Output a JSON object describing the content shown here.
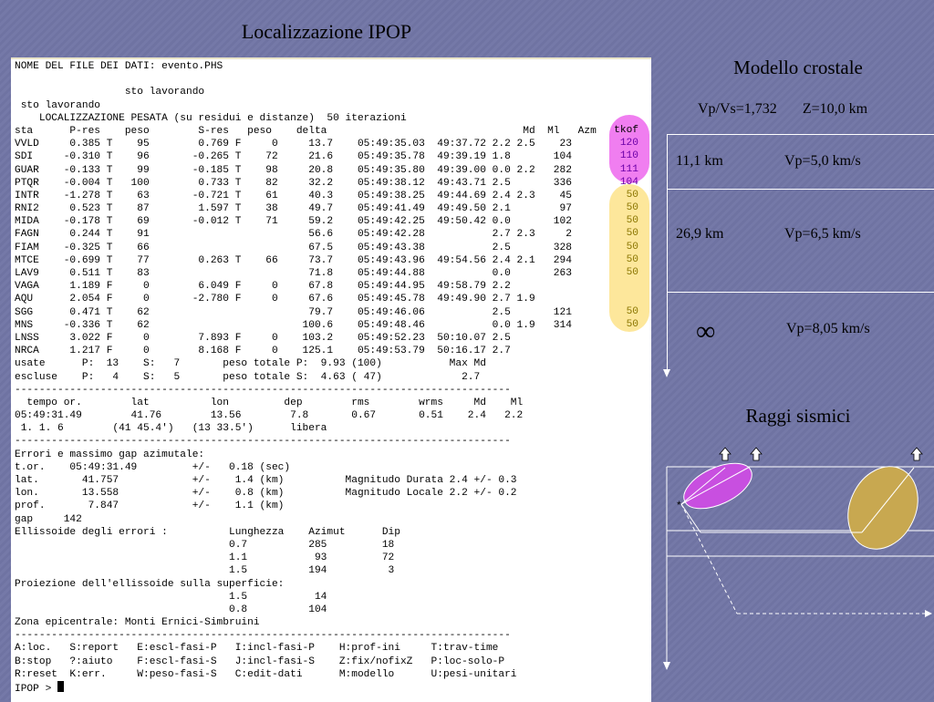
{
  "slide": {
    "title": "Localizzazione IPOP"
  },
  "terminal": {
    "lines": [
      "NOME DEL FILE DEI DATI: evento.PHS",
      "",
      "                  sto lavorando",
      " sto lavorando",
      "    LOCALIZZAZIONE PESATA (su residui e distanze)  50 iterazioni",
      "sta      P-res    peso        S-res   peso    delta                                Md  Ml   Azm",
      "VVLD     0.385 T    95        0.769 F     0     13.7    05:49:35.03  49:37.72 2.2 2.5    23",
      "SDI     -0.310 T    96       -0.265 T    72     21.6    05:49:35.78  49:39.19 1.8       104",
      "GUAR    -0.133 T    99       -0.185 T    98     20.8    05:49:35.80  49:39.00 0.0 2.2   282",
      "PTQR    -0.004 T   100        0.733 T    82     32.2    05:49:38.12  49:43.71 2.5       336",
      "INTR    -1.278 T    63       -0.721 T    61     40.3    05:49:38.25  49:44.69 2.4 2.3    45",
      "RNI2     0.523 T    87        1.597 T    38     49.7    05:49:41.49  49:49.50 2.1        97",
      "MIDA    -0.178 T    69       -0.012 T    71     59.2    05:49:42.25  49:50.42 0.0       102",
      "FAGN     0.244 T    91                          56.6    05:49:42.28           2.7 2.3     2",
      "FIAM    -0.325 T    66                          67.5    05:49:43.38           2.5       328",
      "MTCE    -0.699 T    77        0.263 T    66     73.7    05:49:43.96  49:54.56 2.4 2.1   294",
      "LAV9     0.511 T    83                          71.8    05:49:44.88           0.0       263",
      "VAGA     1.189 F     0        6.049 F     0     67.8    05:49:44.95  49:58.79 2.2",
      "AQU      2.054 F     0       -2.780 F     0     67.6    05:49:45.78  49:49.90 2.7 1.9",
      "SGG      0.471 T    62                          79.7    05:49:46.06           2.5       121",
      "MNS     -0.336 T    62                         100.6    05:49:48.46           0.0 1.9   314",
      "LNSS     3.022 F     0        7.893 F     0    103.2    05:49:52.23  50:10.07 2.5",
      "NRCA     1.217 F     0        8.168 F     0    125.1    05:49:53.79  50:16.17 2.7",
      "usate      P:  13    S:   7       peso totale P:  9.93 (100)           Max Md",
      "escluse    P:   4    S:   5       peso totale S:  4.63 ( 47)             2.7",
      "---------------------------------------------------------------------------------",
      "  tempo or.        lat          lon         dep        rms        wrms     Md    Ml",
      "05:49:31.49        41.76        13.56        7.8       0.67       0.51    2.4   2.2",
      " 1. 1. 6        (41 45.4')   (13 33.5')      libera",
      "---------------------------------------------------------------------------------",
      "Errori e massimo gap azimutale:",
      "t.or.    05:49:31.49         +/-   0.18 (sec)",
      "lat.       41.757            +/-    1.4 (km)          Magnitudo Durata 2.4 +/- 0.3",
      "lon.       13.558            +/-    0.8 (km)          Magnitudo Locale 2.2 +/- 0.2",
      "prof.       7.847            +/-    1.1 (km)",
      "gap     142",
      "Ellissoide degli errori :          Lunghezza    Azimut      Dip",
      "                                   0.7          285         18",
      "                                   1.1           93         72",
      "                                   1.5          194          3",
      "Proiezione dell'ellissoide sulla superficie:",
      "                                   1.5           14",
      "                                   0.8          104",
      "Zona epicentrale: Monti Ernici-Simbruini",
      "---------------------------------------------------------------------------------",
      "A:loc.   S:report   E:escl-fasi-P   I:incl-fasi-P    H:prof-ini     T:trav-time",
      "B:stop   ?:aiuto    F:escl-fasi-S   J:incl-fasi-S    Z:fix/nofixZ   P:loc-solo-P",
      "R:reset  K:err.     W:peso-fasi-S   C:edit-dati      M:modello      U:pesi-unitari",
      "IPOP >"
    ],
    "tkof_header": "tkof",
    "tkof_pink": [
      "120",
      "110",
      "111",
      "104"
    ],
    "tkof_yellow": [
      "50",
      "50",
      "50",
      "50",
      "50",
      "50",
      "50",
      "",
      "",
      "50",
      "50"
    ]
  },
  "model": {
    "title": "Modello crostale",
    "vpvs": "Vp/Vs=1,732",
    "z": "Z=10,0 km",
    "layer1_depth": "11,1  km",
    "layer1_vp": "Vp=5,0 km/s",
    "layer2_depth": "26,9  km",
    "layer2_vp": "Vp=6,5 km/s",
    "halfspace_symbol": "∞",
    "halfspace_vp": "Vp=8,05 km/s"
  },
  "rays": {
    "title": "Raggi sismici",
    "colors": {
      "pink": "#c84fe0",
      "yellow": "#c8a850"
    }
  }
}
